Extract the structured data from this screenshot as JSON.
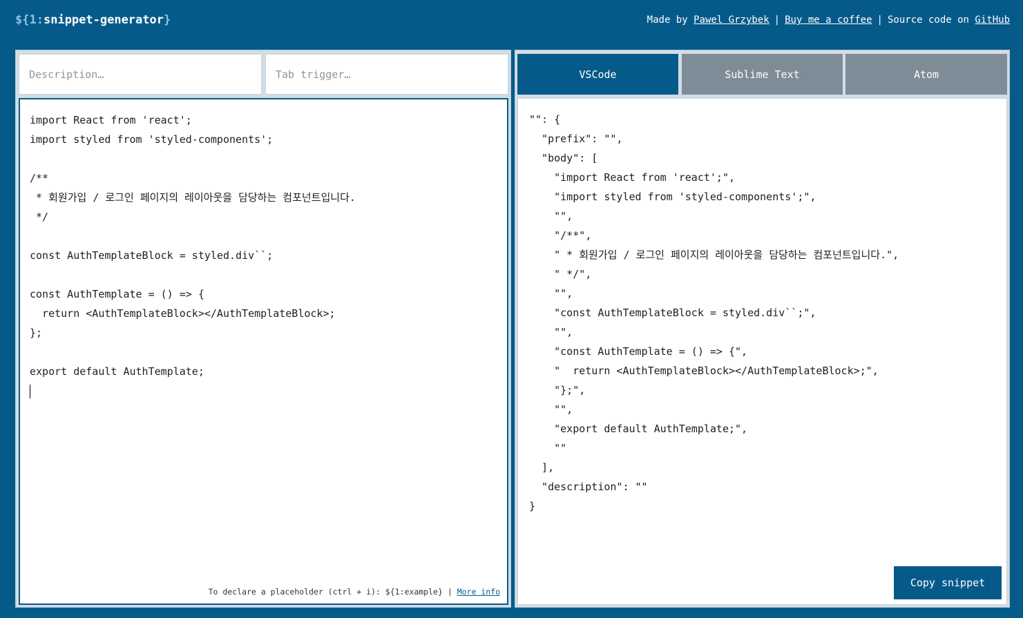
{
  "header": {
    "logo_prefix": "${",
    "logo_number": "1",
    "logo_colon": ":",
    "logo_name": "snippet-generator",
    "logo_suffix": "}",
    "made_by": "Made by ",
    "author": "Pawel Grzybek",
    "sep1": "|",
    "coffee": "Buy me a coffee",
    "sep2": "|",
    "source_prefix": "Source code on ",
    "github": "GitHub"
  },
  "inputs": {
    "description_placeholder": "Description…",
    "description_value": "",
    "trigger_placeholder": "Tab trigger…",
    "trigger_value": ""
  },
  "editor": {
    "code": "import React from 'react';\nimport styled from 'styled-components';\n\n/**\n * 회원가입 / 로그인 페이지의 레이아웃을 담당하는 컴포넌트입니다.\n */\n\nconst AuthTemplateBlock = styled.div``;\n\nconst AuthTemplate = () => {\n  return <AuthTemplateBlock></AuthTemplateBlock>;\n};\n\nexport default AuthTemplate;\n",
    "hint_text": "To declare a placeholder (ctrl + i): ${1:example}",
    "hint_sep": "|",
    "hint_link": "More info"
  },
  "tabs": [
    {
      "label": "VSCode",
      "active": true
    },
    {
      "label": "Sublime Text",
      "active": false
    },
    {
      "label": "Atom",
      "active": false
    }
  ],
  "output": {
    "code": "\"\": {\n  \"prefix\": \"\",\n  \"body\": [\n    \"import React from 'react';\",\n    \"import styled from 'styled-components';\",\n    \"\",\n    \"/**\",\n    \" * 회원가입 / 로그인 페이지의 레이아웃을 담당하는 컴포넌트입니다.\",\n    \" */\",\n    \"\",\n    \"const AuthTemplateBlock = styled.div``;\",\n    \"\",\n    \"const AuthTemplate = () => {\",\n    \"  return <AuthTemplateBlock></AuthTemplateBlock>;\",\n    \"};\",\n    \"\",\n    \"export default AuthTemplate;\",\n    \"\"\n  ],\n  \"description\": \"\"\n}",
    "copy_label": "Copy snippet"
  },
  "colors": {
    "background": "#065a8a",
    "tab_inactive": "#7e8c97",
    "panel": "#d2dde6"
  }
}
